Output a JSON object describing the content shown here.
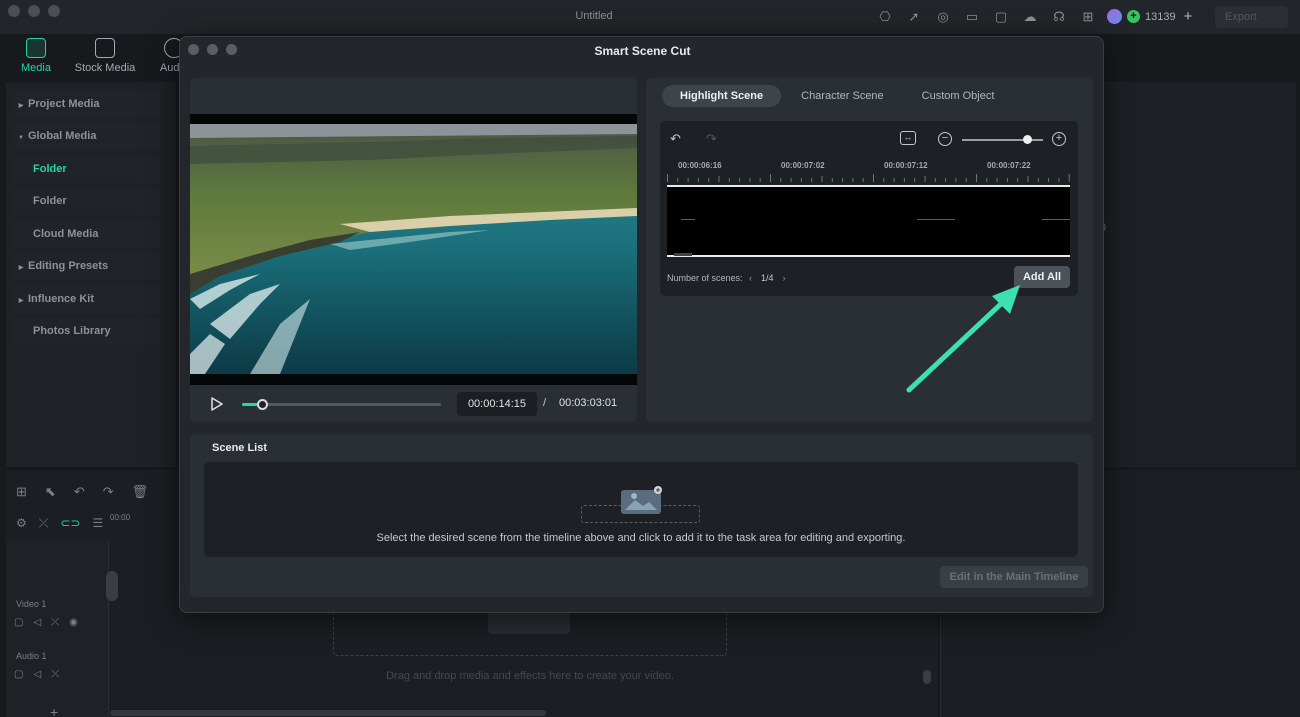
{
  "app": {
    "title": "Untitled",
    "credits": "13139",
    "export_label": "Export",
    "top_tabs": [
      {
        "label": "Media",
        "active": true
      },
      {
        "label": "Stock Media",
        "active": false
      },
      {
        "label": "Audio",
        "active": false
      }
    ],
    "sidebar": [
      {
        "label": "Project Media",
        "expander": "right"
      },
      {
        "label": "Global Media",
        "expander": "down"
      },
      {
        "label": "Folder",
        "expander": "",
        "active": true
      },
      {
        "label": "Folder",
        "expander": ""
      },
      {
        "label": "Cloud Media",
        "expander": ""
      },
      {
        "label": "Editing Presets",
        "expander": "right"
      },
      {
        "label": "Influence Kit",
        "expander": "right"
      },
      {
        "label": "Photos Library",
        "expander": ""
      }
    ],
    "right_fragment": "9",
    "timeline": {
      "ruler_start": "00:00",
      "tracks": [
        {
          "label": "Video 1"
        },
        {
          "label": "Audio 1"
        }
      ],
      "drop_hint": "Drag and drop media and effects here to create your video."
    }
  },
  "modal": {
    "title": "Smart Scene Cut",
    "player": {
      "current_time": "00:00:14:15",
      "separator": "/",
      "total_time": "00:03:03:01",
      "progress": 0.1
    },
    "tabs": [
      {
        "label": "Highlight Scene",
        "active": true
      },
      {
        "label": "Character Scene",
        "active": false
      },
      {
        "label": "Custom Object",
        "active": false
      }
    ],
    "editor": {
      "ruler_labels": [
        "00:00:06:16",
        "00:00:07:02",
        "00:00:07:12",
        "00:00:07:22"
      ],
      "zoom_level": 0.8,
      "scenes_label": "Number of scenes:",
      "scenes_prev": "‹",
      "scenes_value": "1/4",
      "scenes_next": "›",
      "add_all_label": "Add All"
    },
    "scene_list": {
      "title": "Scene List",
      "hint": "Select the desired scene from the timeline above and click to add it to the task area for editing and exporting.",
      "edit_button": "Edit in the Main Timeline"
    }
  },
  "colors": {
    "accent": "#22d6a8",
    "arrow": "#3de0b0"
  }
}
